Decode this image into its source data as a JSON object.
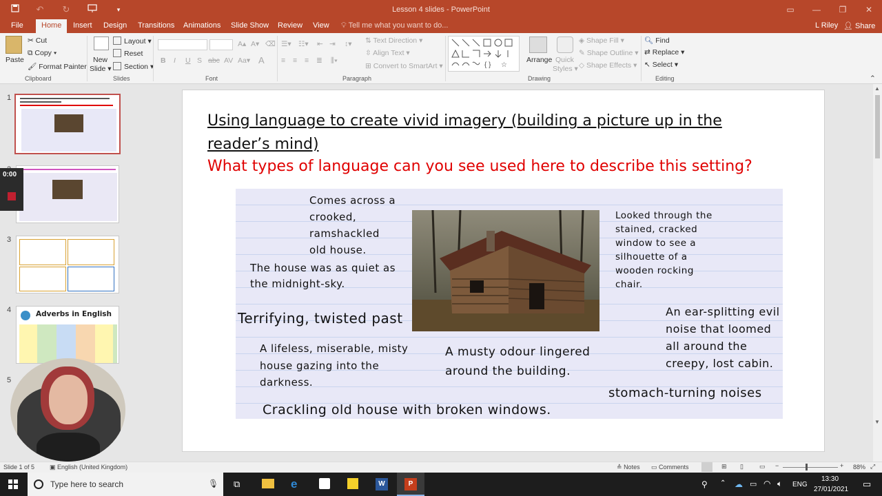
{
  "titlebar": {
    "title": "Lesson 4 slides - PowerPoint"
  },
  "tabs": {
    "items": [
      "File",
      "Home",
      "Insert",
      "Design",
      "Transitions",
      "Animations",
      "Slide Show",
      "Review",
      "View"
    ],
    "tell_me": "Tell me what you want to do...",
    "user": "L Riley",
    "share": "Share"
  },
  "ribbon": {
    "clipboard": {
      "paste": "Paste",
      "cut": "Cut",
      "copy": "Copy",
      "format_painter": "Format Painter",
      "label": "Clipboard"
    },
    "slides": {
      "new_slide": "New",
      "new_slide_2": "Slide",
      "layout": "Layout",
      "reset": "Reset",
      "section": "Section",
      "label": "Slides"
    },
    "font": {
      "label": "Font"
    },
    "paragraph": {
      "text_direction": "Text Direction",
      "align_text": "Align Text",
      "convert": "Convert to SmartArt",
      "label": "Paragraph"
    },
    "drawing": {
      "arrange": "Arrange",
      "quick_styles": "Quick",
      "quick_styles_2": "Styles",
      "shape_fill": "Shape Fill",
      "shape_outline": "Shape Outline",
      "shape_effects": "Shape Effects",
      "label": "Drawing"
    },
    "editing": {
      "find": "Find",
      "replace": "Replace",
      "select": "Select",
      "label": "Editing"
    }
  },
  "thumbnails": {
    "numbers": [
      "1",
      "2",
      "3",
      "4",
      "5"
    ],
    "t4_title": "Adverbs in English",
    "timer": "0:00"
  },
  "slide": {
    "title": "Using language to create vivid imagery (building a picture up in the reader’s mind)",
    "question": "What types of language can you see used here to describe this setting?",
    "phrases": {
      "p1": [
        "Comes across a",
        "crooked,",
        "ramshackled",
        "old house."
      ],
      "p2": [
        "The house was as quiet as",
        "the midnight-sky."
      ],
      "p3": "Terrifying, twisted past",
      "p4": [
        "A lifeless, miserable, misty",
        "house gazing into the",
        "darkness."
      ],
      "p5": [
        "A musty odour lingered",
        "around the building."
      ],
      "p6": "Crackling old house with broken windows.",
      "p7": [
        "Looked through the",
        "stained, cracked",
        "window to see a",
        "silhouette of a",
        "wooden rocking",
        "chair."
      ],
      "p8": [
        "An ear-splitting evil",
        "noise that loomed",
        "all around the",
        "creepy, lost cabin."
      ],
      "p9": "stomach-turning noises"
    }
  },
  "statusbar": {
    "slide_info": "Slide 1 of 5",
    "language": "English (United Kingdom)",
    "notes": "Notes",
    "comments": "Comments",
    "zoom": "88%"
  },
  "taskbar": {
    "search_placeholder": "Type here to search",
    "lang": "ENG",
    "time": "13:30",
    "date": "27/01/2021"
  }
}
